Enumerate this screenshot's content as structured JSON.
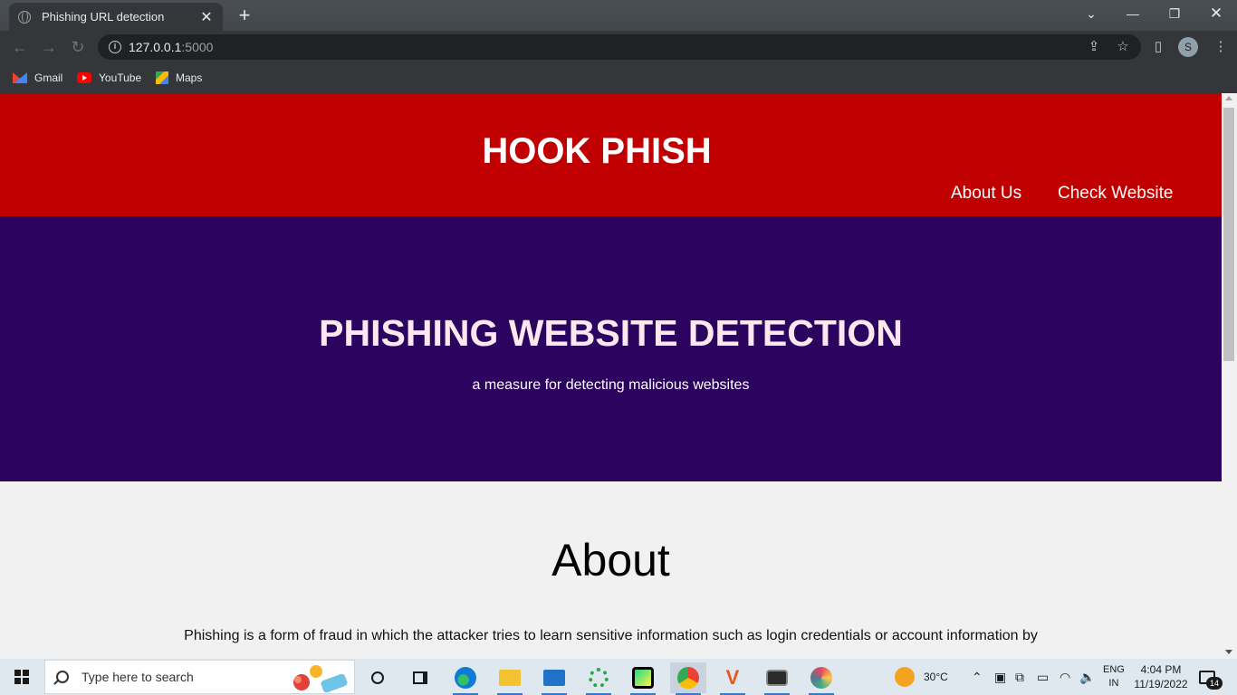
{
  "browser": {
    "tab_title": "Phishing URL detection",
    "new_tab": "+",
    "address_host": "127.0.0.1",
    "address_port": ":5000",
    "profile_initial": "S",
    "bookmarks": [
      {
        "label": "Gmail"
      },
      {
        "label": "YouTube"
      },
      {
        "label": "Maps"
      }
    ]
  },
  "site": {
    "brand": "HOOK PHISH",
    "nav": [
      "About Us",
      "Check Website"
    ],
    "hero_title": "PHISHING WEBSITE DETECTION",
    "hero_subtitle": "a measure for detecting malicious websites",
    "about_heading": "About",
    "about_text": "Phishing is a form of fraud in which the attacker tries to learn sensitive information such as login credentials or account information by"
  },
  "colors": {
    "header_red": "#c00000",
    "hero_purple": "#2d0360",
    "hero_title_color": "#fde8ef",
    "page_bg": "#f1f1f1"
  },
  "taskbar": {
    "search_placeholder": "Type here to search",
    "weather": "30°C",
    "lang_top": "ENG",
    "lang_bottom": "IN",
    "time": "4:04 PM",
    "date": "11/19/2022",
    "notifications": "14",
    "apps": [
      "cortana-icon",
      "task-view-icon",
      "edge-icon",
      "file-explorer-icon",
      "mail-icon",
      "circle-app-icon",
      "pycharm-icon",
      "chrome-icon",
      "vector-app-icon",
      "terminal-icon",
      "paint-icon"
    ]
  }
}
